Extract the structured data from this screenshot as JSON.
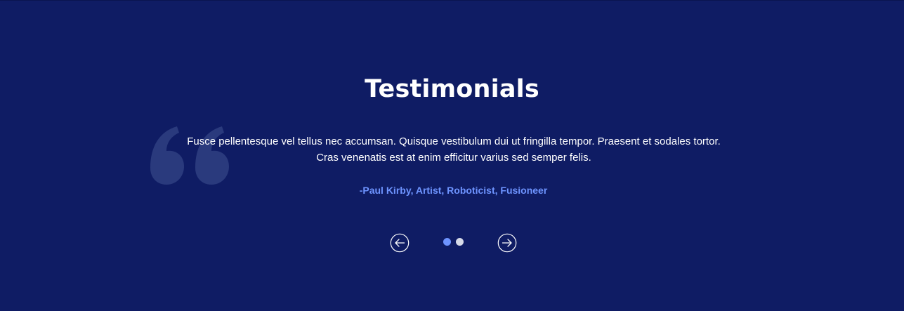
{
  "section": {
    "title": "Testimonials",
    "quote": {
      "line1": "Fusce pellentesque vel tellus nec accumsan. Quisque vestibulum dui ut fringilla tempor. Praesent et sodales tortor.",
      "line2": "Cras venenatis est at enim efficitur varius sed semper felis."
    },
    "author": "-Paul Kirby, Artist, Roboticist, Fusioneer"
  },
  "carousel": {
    "prev_icon": "arrow-left-circle-icon",
    "next_icon": "arrow-right-circle-icon",
    "slide_count": 2,
    "active_index": 0
  },
  "colors": {
    "background": "#0f1c64",
    "accent": "#6e94ff",
    "quote_mark": "#2a3a7d",
    "inactive_dot": "#d6dae8",
    "text": "#ffffff"
  }
}
